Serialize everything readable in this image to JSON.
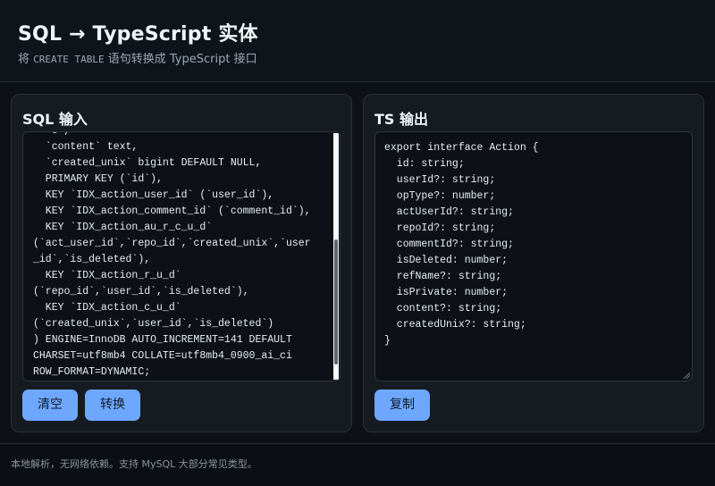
{
  "header": {
    "title": "SQL → TypeScript 实体",
    "subtitle_prefix": "将 ",
    "subtitle_code": "CREATE TABLE",
    "subtitle_suffix": " 语句转换成 TypeScript 接口"
  },
  "sql_panel": {
    "title": "SQL 输入",
    "value": "  `o`,\n  `content` text,\n  `created_unix` bigint DEFAULT NULL,\n  PRIMARY KEY (`id`),\n  KEY `IDX_action_user_id` (`user_id`),\n  KEY `IDX_action_comment_id` (`comment_id`),\n  KEY `IDX_action_au_r_c_u_d`\n(`act_user_id`,`repo_id`,`created_unix`,`user\n_id`,`is_deleted`),\n  KEY `IDX_action_r_u_d`\n(`repo_id`,`user_id`,`is_deleted`),\n  KEY `IDX_action_c_u_d`\n(`created_unix`,`user_id`,`is_deleted`)\n) ENGINE=InnoDB AUTO_INCREMENT=141 DEFAULT\nCHARSET=utf8mb4 COLLATE=utf8mb4_0900_ai_ci\nROW_FORMAT=DYNAMIC;",
    "clear_label": "清空",
    "convert_label": "转换"
  },
  "ts_panel": {
    "title": "TS 输出",
    "value": "export interface Action {\n  id: string;\n  userId?: string;\n  opType?: number;\n  actUserId?: string;\n  repoId?: string;\n  commentId?: string;\n  isDeleted: number;\n  refName?: string;\n  isPrivate: number;\n  content?: string;\n  createdUnix?: string;\n}",
    "copy_label": "复制"
  },
  "footer": {
    "text": "本地解析，无网络依赖。支持 MySQL 大部分常见类型。"
  },
  "colors": {
    "background": "#0d1117",
    "panel": "#161b22",
    "accent_button": "#6ea8fe",
    "border": "#2a313c"
  },
  "icons": {
    "resize_grip": "resize-grip-icon"
  }
}
